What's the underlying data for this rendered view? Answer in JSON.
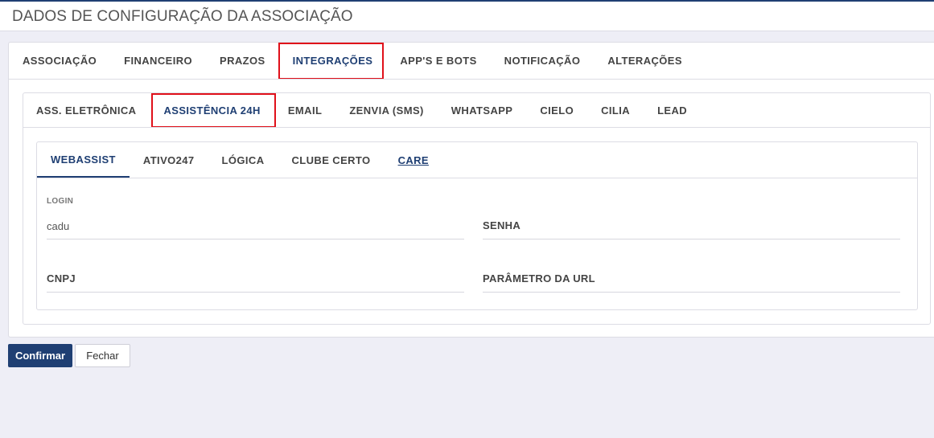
{
  "header": {
    "title": "DADOS DE CONFIGURAÇÃO DA ASSOCIAÇÃO"
  },
  "outer_tabs": [
    {
      "label": "ASSOCIAÇÃO"
    },
    {
      "label": "FINANCEIRO"
    },
    {
      "label": "PRAZOS"
    },
    {
      "label": "INTEGRAÇÕES",
      "active": true
    },
    {
      "label": "APP'S E BOTS"
    },
    {
      "label": "NOTIFICAÇÃO"
    },
    {
      "label": "ALTERAÇÕES"
    }
  ],
  "integration_tabs": [
    {
      "label": "ASS. ELETRÔNICA"
    },
    {
      "label": "ASSISTÊNCIA 24H",
      "active": true
    },
    {
      "label": "EMAIL"
    },
    {
      "label": "ZENVIA (SMS)"
    },
    {
      "label": "WHATSAPP"
    },
    {
      "label": "CIELO"
    },
    {
      "label": "CILIA"
    },
    {
      "label": "LEAD"
    }
  ],
  "assistance_tabs": [
    {
      "label": "WEBASSIST",
      "active": true
    },
    {
      "label": "ATIVO247"
    },
    {
      "label": "LÓGICA"
    },
    {
      "label": "CLUBE CERTO"
    },
    {
      "label": "CARE"
    }
  ],
  "form": {
    "login": {
      "label": "LOGIN",
      "value": "cadu"
    },
    "senha": {
      "label": "SENHA",
      "value": ""
    },
    "cnpj": {
      "label": "CNPJ",
      "value": ""
    },
    "url_param": {
      "label": "PARÂMETRO DA URL",
      "value": ""
    }
  },
  "actions": {
    "confirm_label": "Confirmar",
    "close_label": "Fechar"
  },
  "colors": {
    "accent": "#1f3f73",
    "highlight": "#e0101a",
    "background": "#eeeef6"
  }
}
